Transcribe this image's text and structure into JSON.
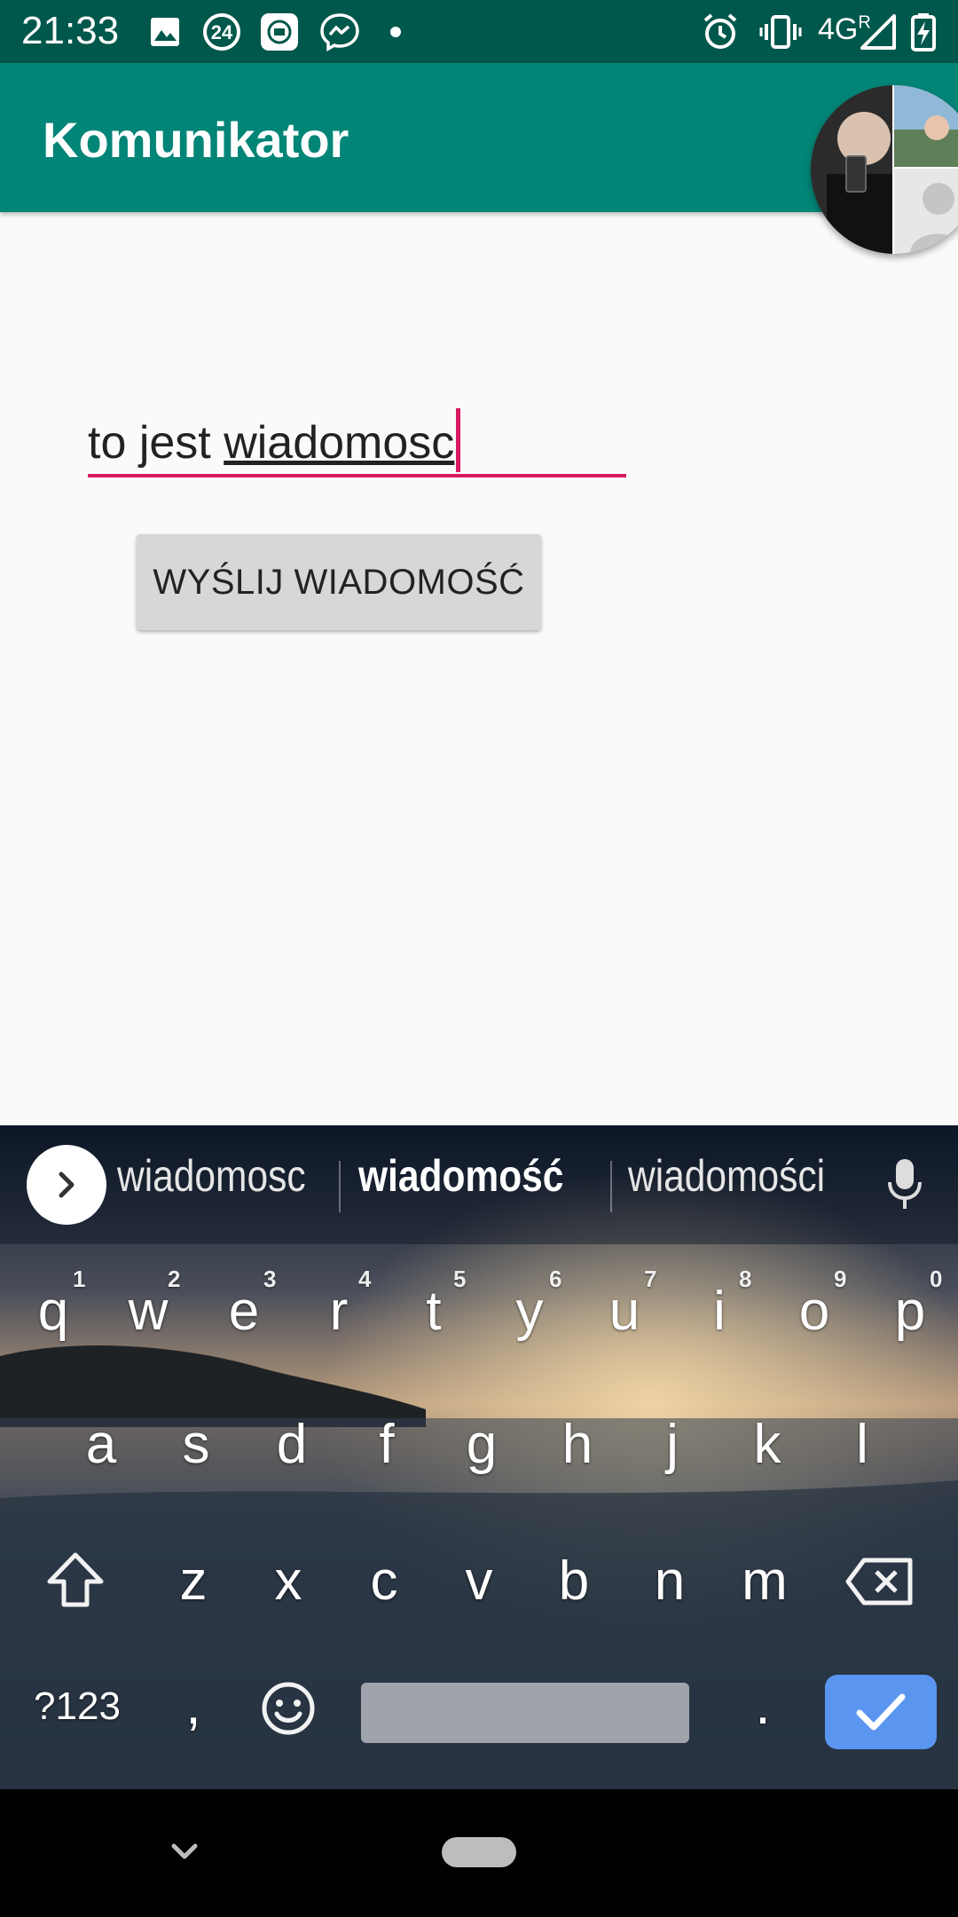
{
  "status_bar": {
    "time": "21:33",
    "notif_badge": "24",
    "network": "4G",
    "roaming": "R"
  },
  "app_bar": {
    "title": "Komunikator"
  },
  "message_input": {
    "text_before": "to jest ",
    "composing_word": "wiadomosc"
  },
  "send_button": {
    "label": "WYŚLIJ WIADOMOŚĆ"
  },
  "keyboard": {
    "suggestions": [
      "wiadomosc",
      "wiadomość",
      "wiadomości"
    ],
    "row1": [
      {
        "key": "q",
        "hint": "1"
      },
      {
        "key": "w",
        "hint": "2"
      },
      {
        "key": "e",
        "hint": "3"
      },
      {
        "key": "r",
        "hint": "4"
      },
      {
        "key": "t",
        "hint": "5"
      },
      {
        "key": "y",
        "hint": "6"
      },
      {
        "key": "u",
        "hint": "7"
      },
      {
        "key": "i",
        "hint": "8"
      },
      {
        "key": "o",
        "hint": "9"
      },
      {
        "key": "p",
        "hint": "0"
      }
    ],
    "row2": [
      "a",
      "s",
      "d",
      "f",
      "g",
      "h",
      "j",
      "k",
      "l"
    ],
    "row3": [
      "z",
      "x",
      "c",
      "v",
      "b",
      "n",
      "m"
    ],
    "symbols_key": "?123",
    "comma_key": ",",
    "period_key": "."
  },
  "colors": {
    "app_bar": "#008577",
    "status_bar": "#00574b",
    "accent": "#d81b60",
    "enter_key": "#5a95f0"
  },
  "icons": [
    "image-icon",
    "notification-24-icon",
    "mi-icon",
    "messenger-icon",
    "dot-icon",
    "alarm-icon",
    "vibrate-icon",
    "signal-icon",
    "battery-charging-icon",
    "chevron-right-icon",
    "microphone-icon",
    "shift-icon",
    "backspace-icon",
    "emoji-icon",
    "check-icon",
    "chevron-down-icon"
  ]
}
